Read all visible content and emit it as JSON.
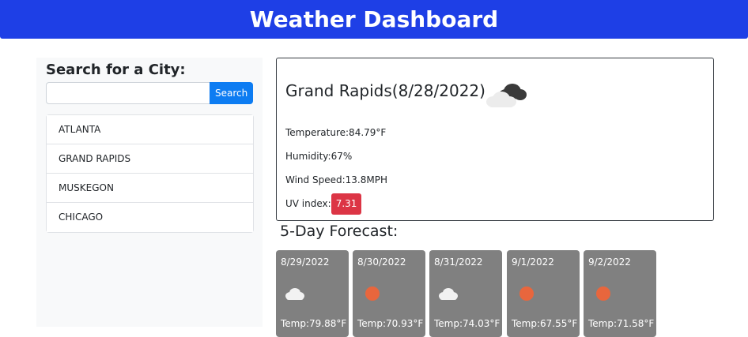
{
  "header": {
    "title": "Weather Dashboard"
  },
  "sidebar": {
    "title": "Search for a City:",
    "search": {
      "value": "",
      "placeholder": "",
      "button_label": "Search"
    },
    "cities": [
      "ATLANTA",
      "GRAND RAPIDS",
      "MUSKEGON",
      "CHICAGO"
    ]
  },
  "current": {
    "title": "Grand Rapids(8/28/2022)",
    "icon": "cloudy-icon",
    "temperature": "Temperature:84.79°F",
    "humidity": "Humidity:67%",
    "wind": "Wind Speed:13.8MPH",
    "uv_label": "UV index:",
    "uv_value": "7.31",
    "uv_color": "#dc3545"
  },
  "forecast": {
    "title": "5-Day Forecast:",
    "card_color": "#808080",
    "days": [
      {
        "date": "8/29/2022",
        "icon": "cloud-icon",
        "temp": "Temp:79.88°F"
      },
      {
        "date": "8/30/2022",
        "icon": "sun-icon",
        "temp": "Temp:70.93°F"
      },
      {
        "date": "8/31/2022",
        "icon": "cloud-icon",
        "temp": "Temp:74.03°F"
      },
      {
        "date": "9/1/2022",
        "icon": "sun-icon",
        "temp": "Temp:67.55°F"
      },
      {
        "date": "9/2/2022",
        "icon": "sun-icon",
        "temp": "Temp:71.58°F"
      }
    ]
  },
  "colors": {
    "header": "#1e3fe6",
    "search_button": "#0d7cf2",
    "sun": "#e8663d"
  }
}
